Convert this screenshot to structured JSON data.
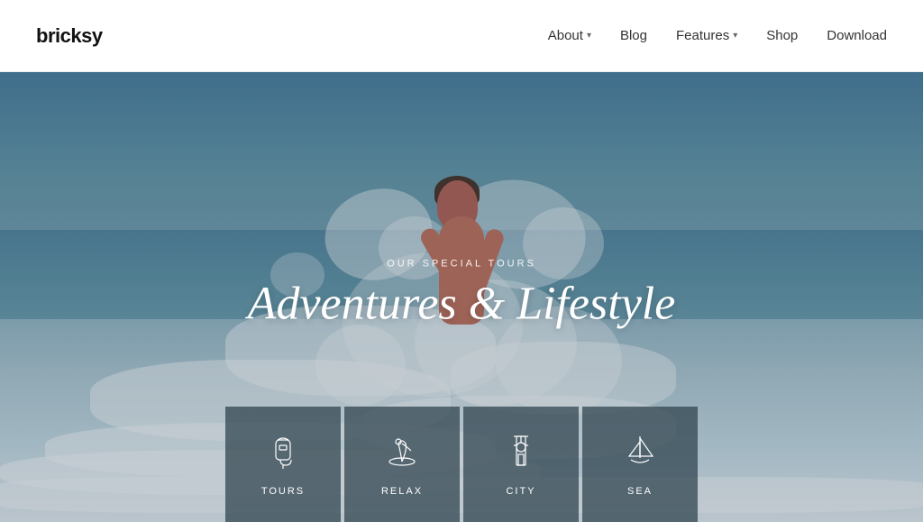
{
  "header": {
    "logo": "bricksy",
    "nav": [
      {
        "id": "about",
        "label": "About",
        "hasDropdown": true
      },
      {
        "id": "blog",
        "label": "Blog",
        "hasDropdown": false
      },
      {
        "id": "features",
        "label": "Features",
        "hasDropdown": true
      },
      {
        "id": "shop",
        "label": "Shop",
        "hasDropdown": false
      },
      {
        "id": "download",
        "label": "Download",
        "hasDropdown": false
      }
    ]
  },
  "hero": {
    "subtitle": "OUR SPECIAL TOURS",
    "title": "Adventures & Lifestyle"
  },
  "tourCards": [
    {
      "id": "tours",
      "label": "TOURS",
      "icon": "backpack"
    },
    {
      "id": "relax",
      "label": "RELAX",
      "icon": "island"
    },
    {
      "id": "city",
      "label": "CITY",
      "icon": "tower"
    },
    {
      "id": "sea",
      "label": "SEA",
      "icon": "sailboat"
    }
  ]
}
